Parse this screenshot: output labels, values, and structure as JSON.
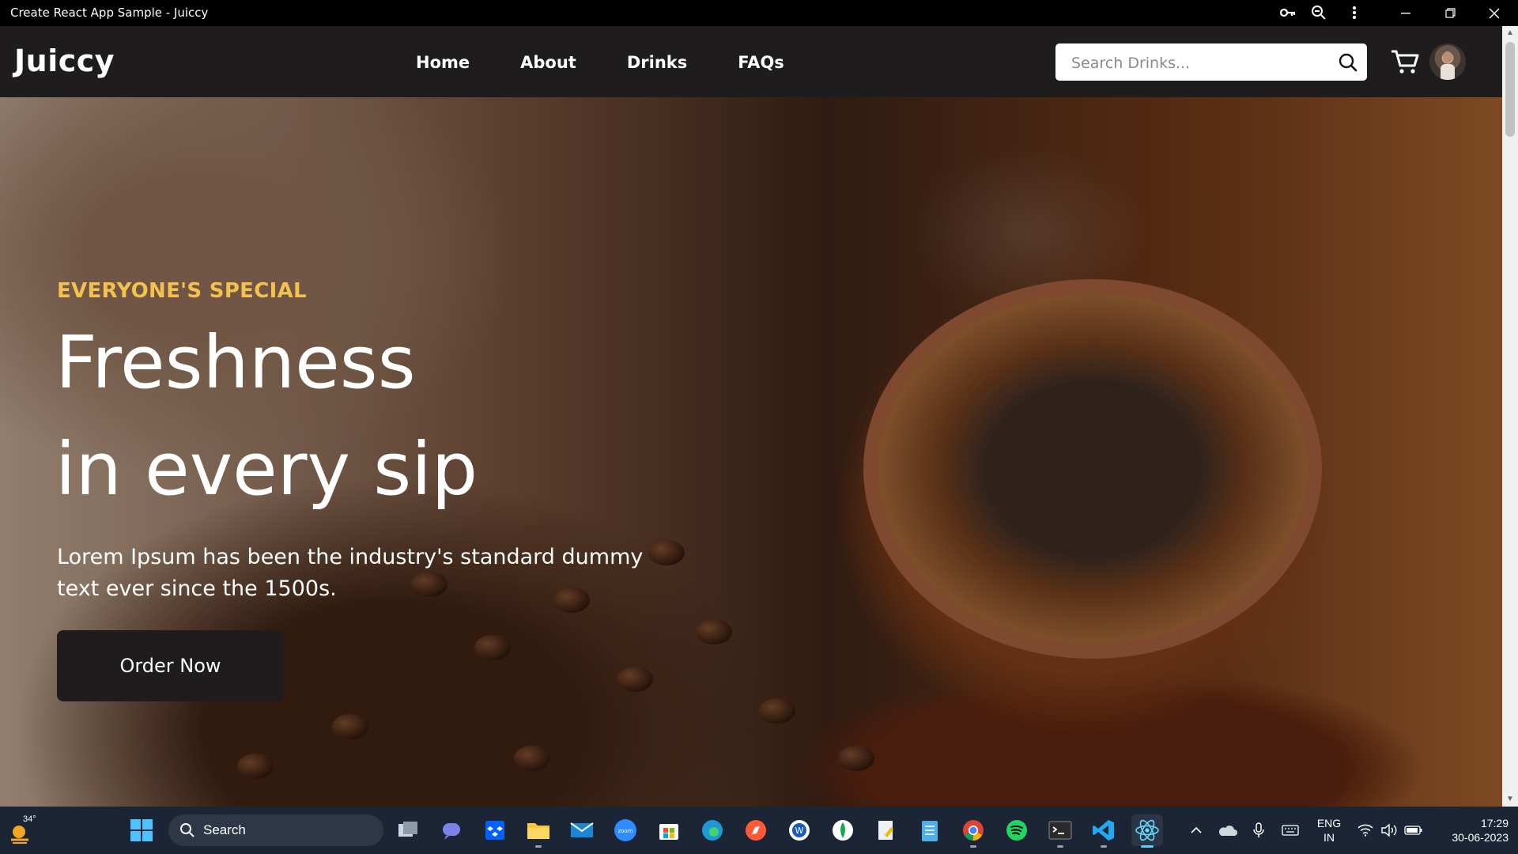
{
  "window": {
    "title": "Create React App Sample - Juiccy"
  },
  "navbar": {
    "brand": "Juiccy",
    "links": [
      "Home",
      "About",
      "Drinks",
      "FAQs"
    ],
    "search": {
      "placeholder": "Search Drinks...",
      "value": ""
    }
  },
  "hero": {
    "eyebrow": "EVERYONE'S SPECIAL",
    "headline_line1": "Freshness",
    "headline_line2": "in every sip",
    "lead": "Lorem Ipsum has been the industry's standard dummy text ever since the 1500s.",
    "cta": "Order Now"
  },
  "taskbar": {
    "weather_temp": "34°",
    "search_label": "Search",
    "lang_line1": "ENG",
    "lang_line2": "IN",
    "time": "17:29",
    "date": "30-06-2023"
  },
  "colors": {
    "accent": "#f2c14e",
    "navbar_bg": "#1e1c1d",
    "taskbar_bg": "#1c2535",
    "active_indicator": "#60cdff"
  }
}
